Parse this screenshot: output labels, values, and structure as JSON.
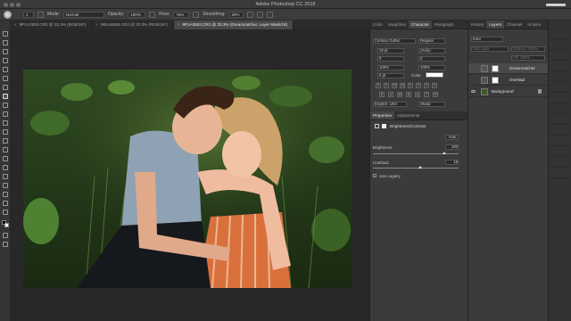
{
  "window": {
    "title": "Adobe Photoshop CC 2018"
  },
  "options_bar": {
    "brush_size": "1",
    "mode_label": "Mode:",
    "mode_value": "Normal",
    "opacity_label": "Opacity:",
    "opacity_value": "100%",
    "flow_label": "Flow:",
    "flow_value": "76%",
    "smoothing_label": "Smoothing:",
    "smoothing_value": "25%"
  },
  "doc_tabs": [
    {
      "label": "9P1A7600.CR2 @ 33.3% (RGB/16*)",
      "active": false
    },
    {
      "label": "9B1A8485.CR2 @ 33.3% (RGB/16*)",
      "active": false
    },
    {
      "label": "9P1A0503.CR2 @ 33.3% (Dreamcatcher, Layer Mask/16)",
      "active": true
    }
  ],
  "character_panel": {
    "tabs": [
      "Color",
      "Swatches",
      "Character",
      "Paragraph"
    ],
    "active_tab": "Character",
    "font_family": "Century Gothic",
    "font_style": "Regular",
    "font_size": "16 pt",
    "leading": "(Auto)",
    "kerning": "0",
    "tracking": "0",
    "vertical_scale": "100%",
    "horizontal_scale": "100%",
    "baseline_shift": "0 pt",
    "color_label": "Color:",
    "language": "English: USA",
    "antialias": "Sharp"
  },
  "properties_panel": {
    "tabs": [
      "Properties",
      "Adjustments"
    ],
    "active_tab": "Properties",
    "title": "Brightness/Contrast",
    "auto_label": "Auto",
    "brightness_label": "Brightness:",
    "brightness_value": "100",
    "contrast_label": "Contrast:",
    "contrast_value": "15",
    "use_legacy_label": "Use Legacy"
  },
  "layers_panel": {
    "tabs": [
      "History",
      "Layers",
      "Channel",
      "Actions"
    ],
    "active_tab": "Layers",
    "filter_value": "Kind",
    "blend_mode": "Soft Light",
    "opacity": "Opacity: 100%",
    "fill": "Fill: 100%",
    "layers": [
      {
        "name": "Dreamcatcher",
        "selected": true
      },
      {
        "name": "Overlaid",
        "selected": false
      },
      {
        "name": "Background",
        "selected": false
      }
    ]
  },
  "colors": {
    "ui_dark": "#3b3b3b",
    "canvas_bg": "#282828",
    "active_tab": "#484848",
    "accent_shirt": "#d9703c"
  }
}
